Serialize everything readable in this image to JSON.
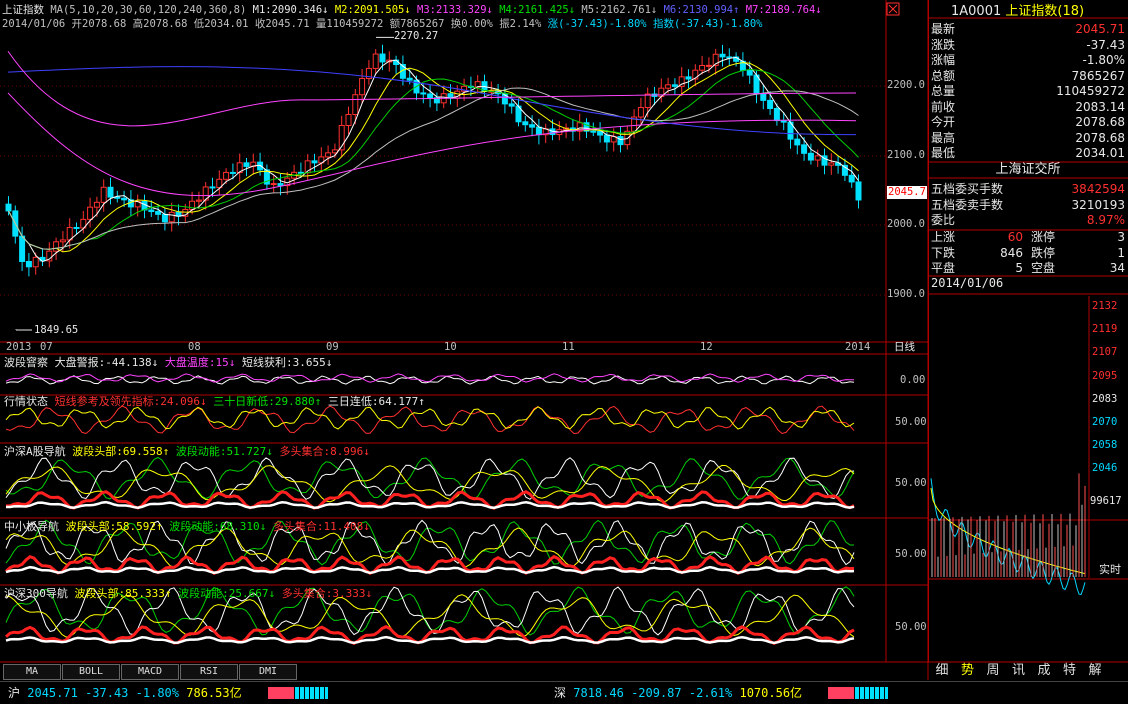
{
  "header": {
    "index_name": "上证指数",
    "ma_label": "MA(5,10,20,30,60,120,240,360,8)",
    "m1": "M1:2090.346↓",
    "m2": "M2:2091.505↓",
    "m3": "M3:2133.329↓",
    "m4": "M4:2161.425↓",
    "m5": "M5:2162.761↓",
    "m6": "M6:2130.994↑",
    "m7": "M7:2189.764↓",
    "date": "2014/01/06",
    "open": "开2078.68",
    "high": "高2078.68",
    "low": "低2034.01",
    "close": "收2045.71",
    "volume": "量110459272",
    "amount": "额7865267",
    "turnover": "换0.00%",
    "amplitude": "振2.14%",
    "change": "涨(-37.43)-1.80%",
    "index_change": "指数(-37.43)-1.80%"
  },
  "main_chart": {
    "price_ticks": [
      "2200.0",
      "2100.0",
      "2000.0",
      "1900.0"
    ],
    "current_price": "2045.7",
    "high_label": "2270.27",
    "low_label": "1849.65",
    "x_labels": [
      "2013",
      "07",
      "08",
      "09",
      "10",
      "11",
      "12",
      "2014"
    ],
    "period": "日线"
  },
  "panels": [
    {
      "name": "波段窨察",
      "items": [
        "大盘警报:-44.138↓",
        "大盘温度:15↓",
        "短线获利:3.655↓"
      ],
      "tick": "0.00"
    },
    {
      "name": "行情状态",
      "items": [
        "短线参考及领先指标:24.096↓",
        "三十日新低:29.880↑",
        "三日连低:64.177↑"
      ],
      "tick": "50.00"
    },
    {
      "name": "沪深A股导航",
      "items": [
        "波段头部:69.558↑",
        "波段动能:51.727↓",
        "多头集合:8.996↓"
      ],
      "tick": "50.00"
    },
    {
      "name": "中小板导航",
      "items": [
        "波段头部:58.592↑",
        "波段动能:68.310↓",
        "多头集合:11.408↓"
      ],
      "tick": "50.00"
    },
    {
      "name": "沪深300导航",
      "items": [
        "波段头部:85.333↑",
        "波段动能:25.667↓",
        "多头集合:3.333↓"
      ],
      "tick": "50.00"
    }
  ],
  "tabs": [
    "MA",
    "BOLL",
    "MACD",
    "RSI",
    "DMI"
  ],
  "sidebar": {
    "code": "1A0001",
    "name": "上证指数(18)",
    "quote": [
      {
        "label": "最新",
        "value": "2045.71",
        "color": "#ff3030"
      },
      {
        "label": "涨跌",
        "value": "-37.43",
        "color": "#e8e8e8"
      },
      {
        "label": "涨幅",
        "value": "-1.80%",
        "color": "#e8e8e8"
      },
      {
        "label": "总额",
        "value": "7865267",
        "color": "#e8e8e8"
      },
      {
        "label": "总量",
        "value": "110459272",
        "color": "#e8e8e8"
      },
      {
        "label": "前收",
        "value": "2083.14",
        "color": "#e8e8e8"
      },
      {
        "label": "今开",
        "value": "2078.68",
        "color": "#e8e8e8"
      },
      {
        "label": "最高",
        "value": "2078.68",
        "color": "#e8e8e8"
      },
      {
        "label": "最低",
        "value": "2034.01",
        "color": "#e8e8e8"
      }
    ],
    "exchange": "上海证交所",
    "order": [
      {
        "label": "五档委买手数",
        "value": "3842594",
        "color": "#ff3030"
      },
      {
        "label": "五档委卖手数",
        "value": "3210193",
        "color": "#e8e8e8"
      },
      {
        "label": "委比",
        "value": "8.97%",
        "color": "#ff3030"
      }
    ],
    "breadth": [
      {
        "l1": "上涨",
        "v1": "60",
        "l2": "涨停",
        "v2": "3",
        "c1": "#ff3030"
      },
      {
        "l1": "下跌",
        "v1": "846",
        "l2": "跌停",
        "v2": "1",
        "c1": "#e8e8e8"
      },
      {
        "l1": "平盘",
        "v1": "5",
        "l2": "空盘",
        "v2": "34",
        "c1": "#e8e8e8"
      }
    ],
    "intraday_date": "2014/01/06",
    "intraday_ticks": [
      "2132",
      "2119",
      "2107",
      "2095",
      "2083",
      "2070",
      "2058",
      "2046"
    ],
    "vol_tick": "99617",
    "realtime": "实时",
    "tabs": [
      "细",
      "势",
      "周",
      "讯",
      "成",
      "特",
      "解"
    ],
    "active_tab": "势"
  },
  "bottom": {
    "sh_label": "沪",
    "sh_value": "2045.71",
    "sh_change": "-37.43",
    "sh_pct": "-1.80%",
    "sh_amount": "786.53亿",
    "sz_label": "深",
    "sz_value": "7818.46",
    "sz_change": "-209.87",
    "sz_pct": "-2.61%",
    "sz_amount": "1070.56亿"
  },
  "colors": {
    "up": "#ff3030",
    "down": "#00e0ff",
    "ma1": "#ffffff",
    "ma2": "#ffff00",
    "ma3": "#ff44ff",
    "ma4": "#00d000",
    "ma5": "#c0c0c0",
    "ma6": "#4040ff",
    "ma7": "#ff44ff"
  }
}
